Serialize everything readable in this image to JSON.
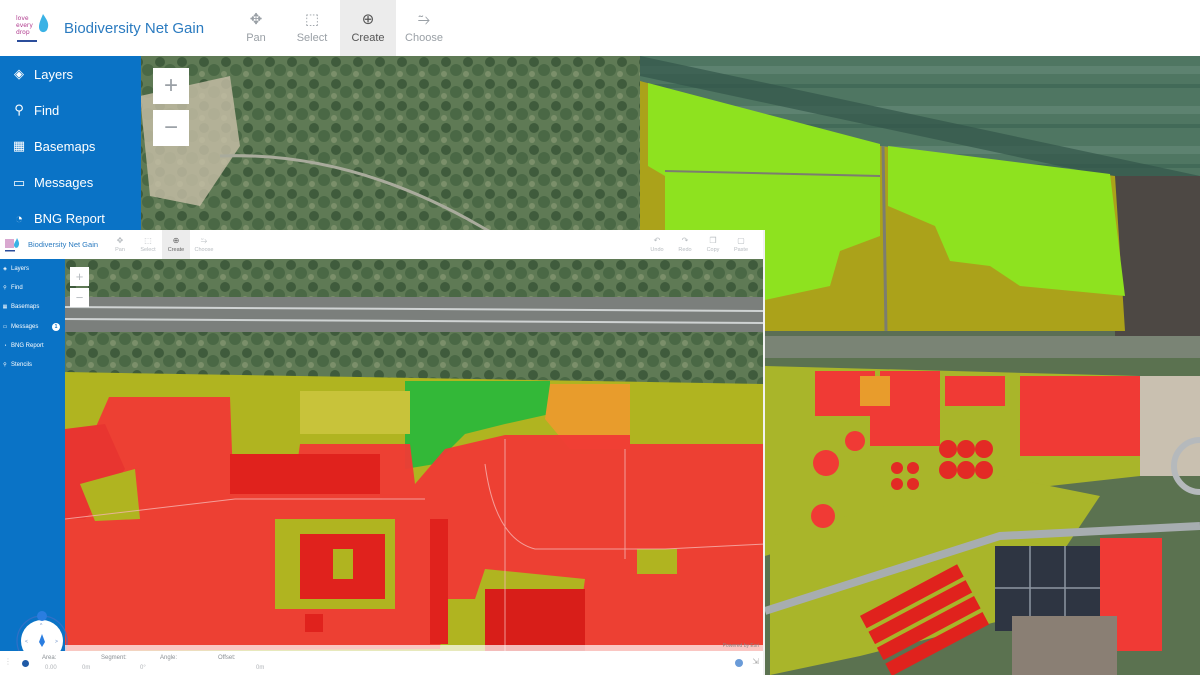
{
  "app": {
    "title": "Biodiversity Net Gain",
    "logo_text": "love every drop"
  },
  "toolbar": {
    "tools": [
      {
        "label": "Pan",
        "icon": "move-icon",
        "glyph": "✥",
        "active": false
      },
      {
        "label": "Select",
        "icon": "select-icon",
        "glyph": "⬚",
        "active": false
      },
      {
        "label": "Create",
        "icon": "plus-circle-icon",
        "glyph": "⊕",
        "active": true
      },
      {
        "label": "Choose",
        "icon": "choose-icon",
        "glyph": "⥲",
        "active": false
      }
    ]
  },
  "sidebar": {
    "items": [
      {
        "label": "Layers",
        "icon": "layers-icon",
        "glyph": "◈"
      },
      {
        "label": "Find",
        "icon": "search-icon",
        "glyph": "⚲"
      },
      {
        "label": "Basemaps",
        "icon": "grid-icon",
        "glyph": "▦"
      },
      {
        "label": "Messages",
        "icon": "message-icon",
        "glyph": "▭"
      },
      {
        "label": "BNG Report",
        "icon": "pie-chart-icon",
        "glyph": "◔"
      }
    ]
  },
  "map": {
    "zoom_in": "+",
    "zoom_out": "−",
    "colors": {
      "red": "#f03a35",
      "lime": "#8ee21f",
      "olive": "#b4b41e",
      "green": "#33b838",
      "orange": "#e89c2c",
      "accent": "#0a73c6"
    }
  },
  "inset": {
    "title": "Biodiversity Net Gain",
    "tools": [
      {
        "label": "Pan",
        "glyph": "✥",
        "active": false
      },
      {
        "label": "Select",
        "glyph": "⬚",
        "active": false
      },
      {
        "label": "Create",
        "glyph": "⊕",
        "active": true
      },
      {
        "label": "Choose",
        "glyph": "⥲",
        "active": false
      }
    ],
    "right_tools": [
      {
        "label": "Undo",
        "glyph": "↶"
      },
      {
        "label": "Redo",
        "glyph": "↷"
      },
      {
        "label": "Copy",
        "glyph": "❐"
      },
      {
        "label": "Paste",
        "glyph": "▢"
      }
    ],
    "sidebar": [
      {
        "label": "Layers",
        "glyph": "◈"
      },
      {
        "label": "Find",
        "glyph": "⚲"
      },
      {
        "label": "Basemaps",
        "glyph": "▦"
      },
      {
        "label": "Messages",
        "glyph": "▭",
        "badge": "1"
      },
      {
        "label": "BNG Report",
        "glyph": "◔"
      },
      {
        "label": "Stencils",
        "glyph": "⚲"
      }
    ],
    "zoom_in": "+",
    "zoom_out": "−",
    "attribution": "Powered by Esri",
    "status": {
      "fields": [
        {
          "label": "Area:",
          "value": "0.00"
        },
        {
          "label": "Segment:",
          "value": "0m"
        },
        {
          "label": "Angle:",
          "value": "0°"
        },
        {
          "label": "Offset:",
          "value": "0m"
        }
      ]
    }
  }
}
